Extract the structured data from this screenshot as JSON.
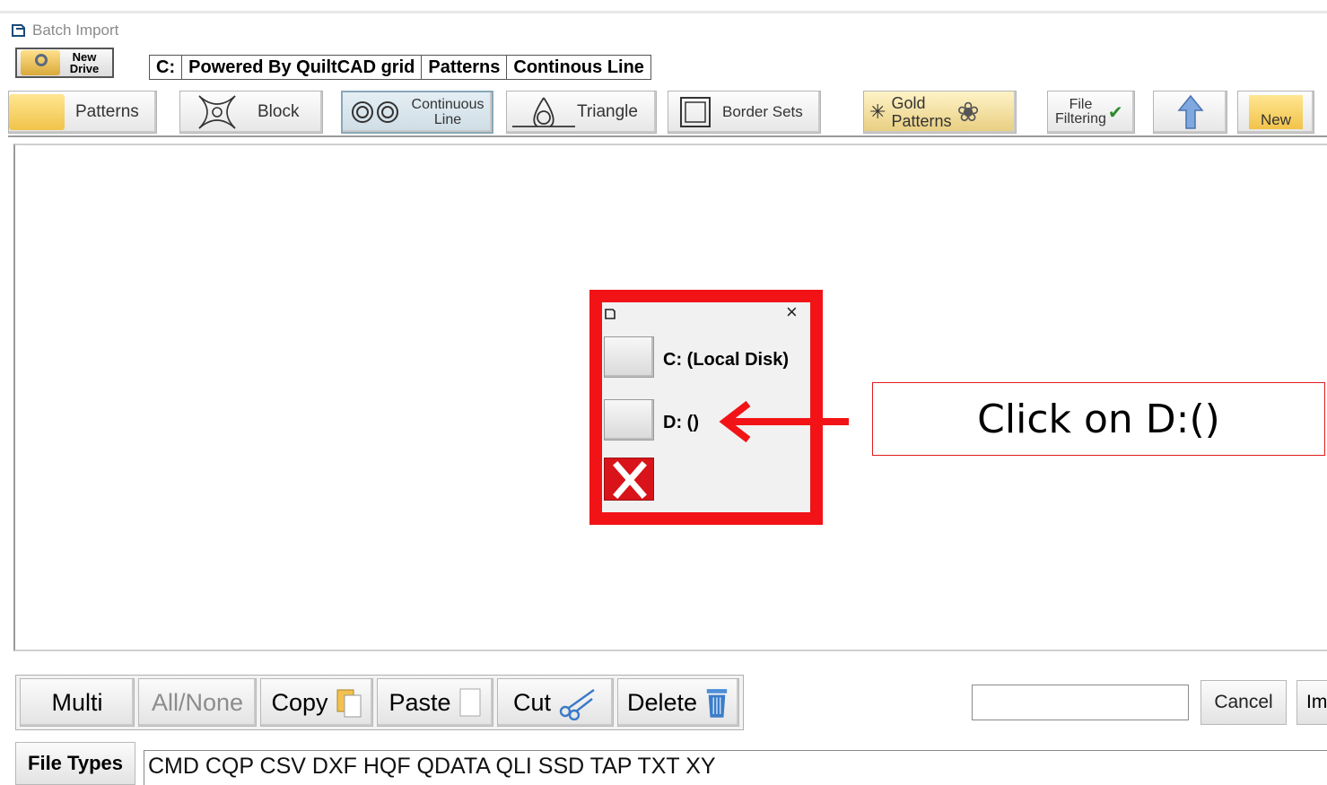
{
  "window": {
    "title": "Batch Import"
  },
  "drive_button": {
    "line1": "New",
    "line2": "Drive"
  },
  "path": [
    "C:",
    "Powered By QuiltCAD grid",
    "Patterns",
    "Continous Line"
  ],
  "toolbar": {
    "patterns": "Patterns",
    "block": "Block",
    "continuous_line1": "Continuous",
    "continuous_line2": "Line",
    "triangle": "Triangle",
    "border_sets": "Border Sets",
    "gold_line1": "Gold",
    "gold_line2": "Patterns",
    "file_filter_line1": "File",
    "file_filter_line2": "Filtering",
    "new": "New"
  },
  "dialog": {
    "drives": [
      {
        "label": "C: (Local Disk)"
      },
      {
        "label": "D: ()"
      }
    ]
  },
  "callout": {
    "text": "Click on D:()"
  },
  "actions": {
    "multi": "Multi",
    "all_none": "All/None",
    "copy": "Copy",
    "paste": "Paste",
    "cut": "Cut",
    "delete": "Delete",
    "cancel": "Cancel",
    "import_partial": "Im"
  },
  "file_types": {
    "label": "File Types",
    "list": "CMD  CQP  CSV  DXF  HQF  QDATA  QLI  SSD  TAP  TXT  XY"
  },
  "colors": {
    "highlight": "#f11316",
    "callout_border": "#e01b1b"
  }
}
